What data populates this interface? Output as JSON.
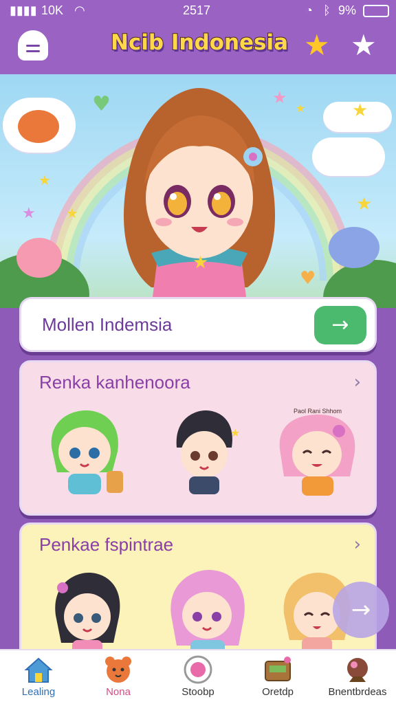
{
  "status_bar": {
    "left": "10K",
    "time": "2517",
    "battery": "9%"
  },
  "header": {
    "title": "Ncib Indonesia",
    "menu_icon": "home-menu-icon",
    "right_icons": [
      "star-gold-icon",
      "star-white-icon"
    ]
  },
  "search": {
    "value": "Mollen Indemsia",
    "button_icon": "arrow-right-icon"
  },
  "section1": {
    "title": "Renka kanhenoora",
    "sign_text": "Paol Rani Shhom"
  },
  "section2": {
    "title": "Penkae fspintrae"
  },
  "bottom_nav": [
    {
      "label": "Lealing",
      "icon": "house-icon"
    },
    {
      "label": "Nona",
      "icon": "bear-icon"
    },
    {
      "label": "Stoobp",
      "icon": "badge-icon"
    },
    {
      "label": "Oretdp",
      "icon": "chest-icon"
    },
    {
      "label": "Bnentbrdeas",
      "icon": "globe-icon"
    }
  ],
  "colors": {
    "accent": "#9a62c2",
    "go": "#4cba6e",
    "title": "#ffd84a"
  }
}
